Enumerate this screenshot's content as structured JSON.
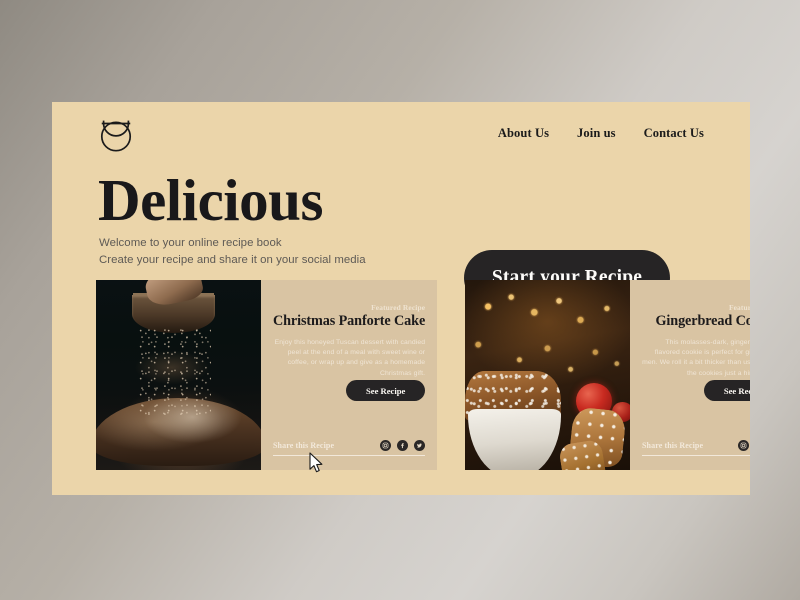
{
  "site": {
    "logo_icon": "bowl-circle-logo-icon",
    "nav": [
      {
        "label": "About Us"
      },
      {
        "label": "Join us"
      },
      {
        "label": "Contact Us"
      }
    ]
  },
  "hero": {
    "title": "Delicious",
    "subtitle_line1": "Welcome to your online recipe book",
    "subtitle_line2": "Create your recipe and share it on your social media",
    "cta_label": "Start your Recipe"
  },
  "cards": [
    {
      "featured_label": "Featured Recipe",
      "title": "Christmas Panforte Cake",
      "description": "Enjoy this honeyed Tuscan dessert with candied peel at the end of a meal with sweet wine or coffee, or wrap up and give as a homemade Christmas gift.",
      "button_label": "See Recipe",
      "share_label": "Share this Recipe",
      "photo_alt": "hand dusting cocoa over a dark chocolate cake",
      "social": [
        {
          "name": "instagram-icon"
        },
        {
          "name": "facebook-icon"
        },
        {
          "name": "twitter-icon"
        }
      ]
    },
    {
      "featured_label": "Featured Recipe",
      "title": "Gingerbread Cookies",
      "description": "This molasses-dark, ginger-and-spice flavored cookie is perfect for gingerbread men. We roll it a bit thicker than usual to give the cookies just a hint of chew.",
      "button_label": "See Recipe",
      "share_label": "Share this Recipe",
      "photo_alt": "gingerbread cookies in a white bowl with warm bokeh lights",
      "social": [
        {
          "name": "instagram-icon"
        },
        {
          "name": "facebook-icon"
        },
        {
          "name": "twitter-icon"
        }
      ]
    }
  ],
  "colors": {
    "hero_background": "#ebd5aa",
    "card_panel": "#d9c4a3",
    "dark": "#262425",
    "light_text": "#f0e5d5",
    "subtitle_text": "#5e5a55",
    "page_background": "#b6b0a7"
  }
}
